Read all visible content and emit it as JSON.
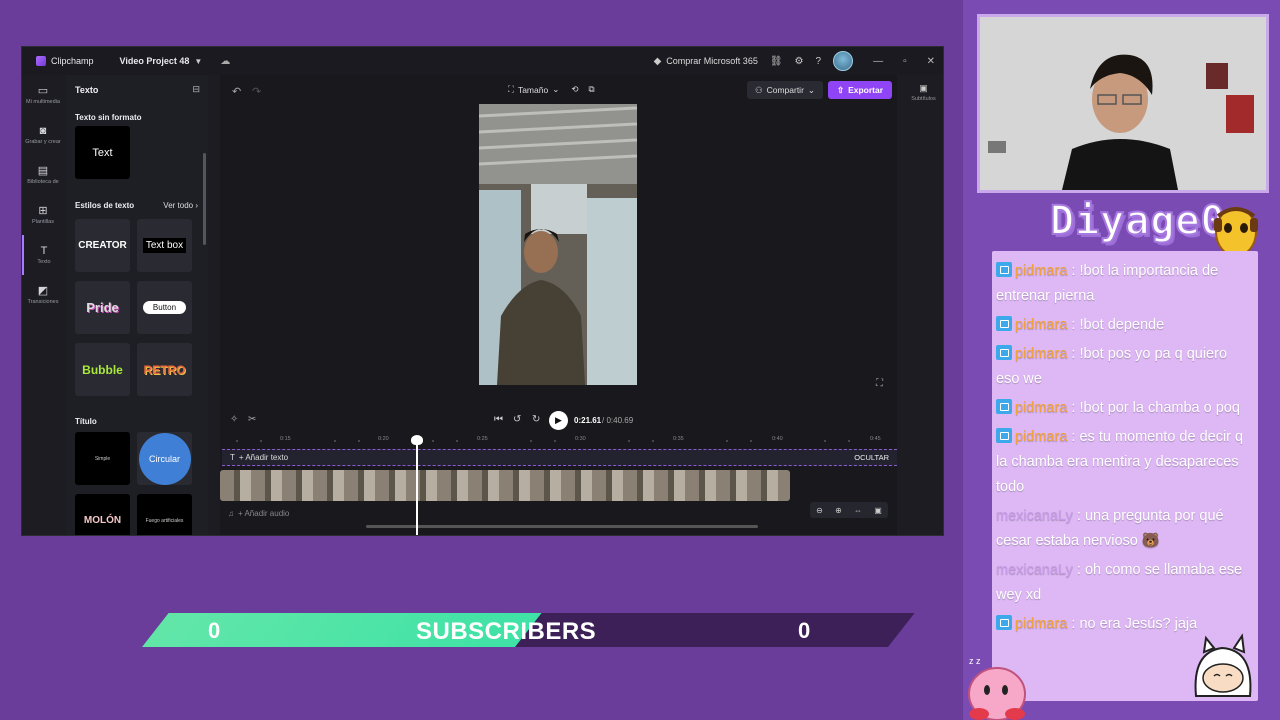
{
  "titlebar": {
    "app_name": "Clipchamp",
    "project_name": "Video Project 48",
    "buy_label": "Comprar Microsoft 365"
  },
  "rail": {
    "items": [
      {
        "label": "Mi multimedia"
      },
      {
        "label": "Grabar y crear"
      },
      {
        "label": "Biblioteca de"
      },
      {
        "label": "Plantillas"
      },
      {
        "label": "Texto"
      },
      {
        "label": "Transiciones"
      }
    ]
  },
  "panel": {
    "title": "Texto",
    "plain_section": "Texto sin formato",
    "plain_tile": "Text",
    "styles_section": "Estilos de texto",
    "see_all": "Ver todo",
    "style_tiles": [
      "CREATOR",
      "Text box",
      "Pride",
      "Button",
      "Bubble",
      "RETRO"
    ],
    "title_section": "Título",
    "title_tiles": [
      "Simple",
      "Circular",
      "MOLÓN",
      "Fuego artificiales"
    ]
  },
  "editor": {
    "size_label": "Tamaño",
    "share_label": "Compartir",
    "export_label": "Exportar",
    "time_current": "0:21.61",
    "time_total": "/ 0:40.69",
    "ruler_labels": [
      "0:15",
      "0:20",
      "0:25",
      "0:30",
      "0:35",
      "0:40",
      "0:45"
    ],
    "add_text_label": "+ Añadir texto",
    "hide_label": "OCULTAR",
    "add_audio_label": "+ Añadir audio",
    "subtitles_label": "Subtítulos"
  },
  "subscribers": {
    "left_count": "0",
    "label": "SUBSCRIBERS",
    "right_count": "0",
    "progress": 0.5
  },
  "stream": {
    "streamer_name": "Diyage0",
    "chat": [
      {
        "user": "pidmara",
        "badge": true,
        "text": "!bot la importancia de entrenar pierna"
      },
      {
        "user": "pidmara",
        "badge": true,
        "text": "!bot depende"
      },
      {
        "user": "pidmara",
        "badge": true,
        "text": "!bot pos yo pa q quiero eso we"
      },
      {
        "user": "pidmara",
        "badge": true,
        "text": "!bot por la chamba o poq"
      },
      {
        "user": "pidmara",
        "badge": true,
        "text": "es tu momento de decir q la chamba era mentira y desapareces todo"
      },
      {
        "user": "mexicanaLy",
        "badge": false,
        "text": "una pregunta por qué cesar estaba nervioso"
      },
      {
        "user": "mexicanaLy",
        "badge": false,
        "text": "oh como se llamaba ese wey xd"
      },
      {
        "user": "pidmara",
        "badge": true,
        "text": "no era Jesús? jaja"
      }
    ]
  }
}
